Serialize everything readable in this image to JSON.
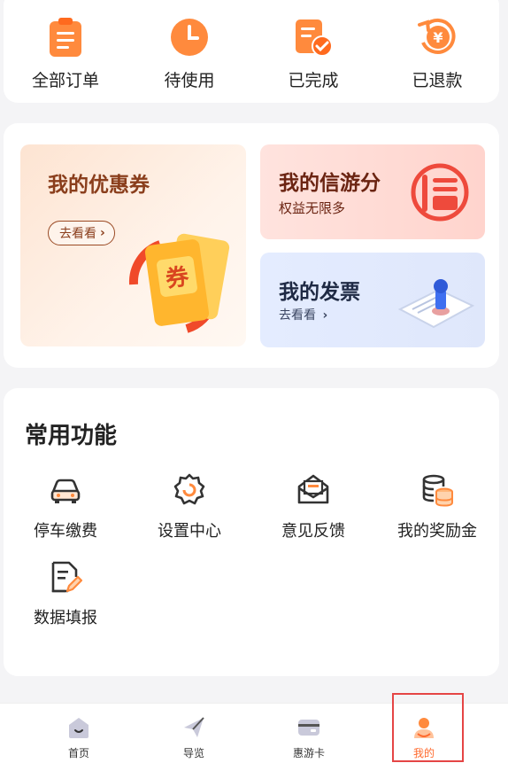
{
  "orders": [
    {
      "label": "全部订单",
      "icon": "clipboard-icon"
    },
    {
      "label": "待使用",
      "icon": "clock-icon"
    },
    {
      "label": "已完成",
      "icon": "document-check-icon"
    },
    {
      "label": "已退款",
      "icon": "refund-yen-icon"
    }
  ],
  "coupon": {
    "title": "我的优惠券",
    "button": "去看看",
    "art_text": "券"
  },
  "credit": {
    "title": "我的信游分",
    "subtitle": "权益无限多"
  },
  "invoice": {
    "title": "我的发票",
    "link": "去看看"
  },
  "functions": {
    "heading": "常用功能",
    "items": [
      {
        "label": "停车缴费",
        "icon": "car-icon"
      },
      {
        "label": "设置中心",
        "icon": "settings-icon"
      },
      {
        "label": "意见反馈",
        "icon": "feedback-mail-icon"
      },
      {
        "label": "我的奖励金",
        "icon": "coins-icon"
      },
      {
        "label": "数据填报",
        "icon": "edit-document-icon"
      }
    ]
  },
  "tabbar": {
    "active": "我的",
    "items": [
      {
        "label": "首页",
        "icon": "home-icon"
      },
      {
        "label": "导览",
        "icon": "paper-plane-icon"
      },
      {
        "label": "惠游卡",
        "icon": "card-icon"
      },
      {
        "label": "我的",
        "icon": "profile-icon"
      }
    ]
  },
  "colors": {
    "accent": "#ff6a2e",
    "coupon_text": "#8a3e1c",
    "highlight": "#e54545"
  }
}
